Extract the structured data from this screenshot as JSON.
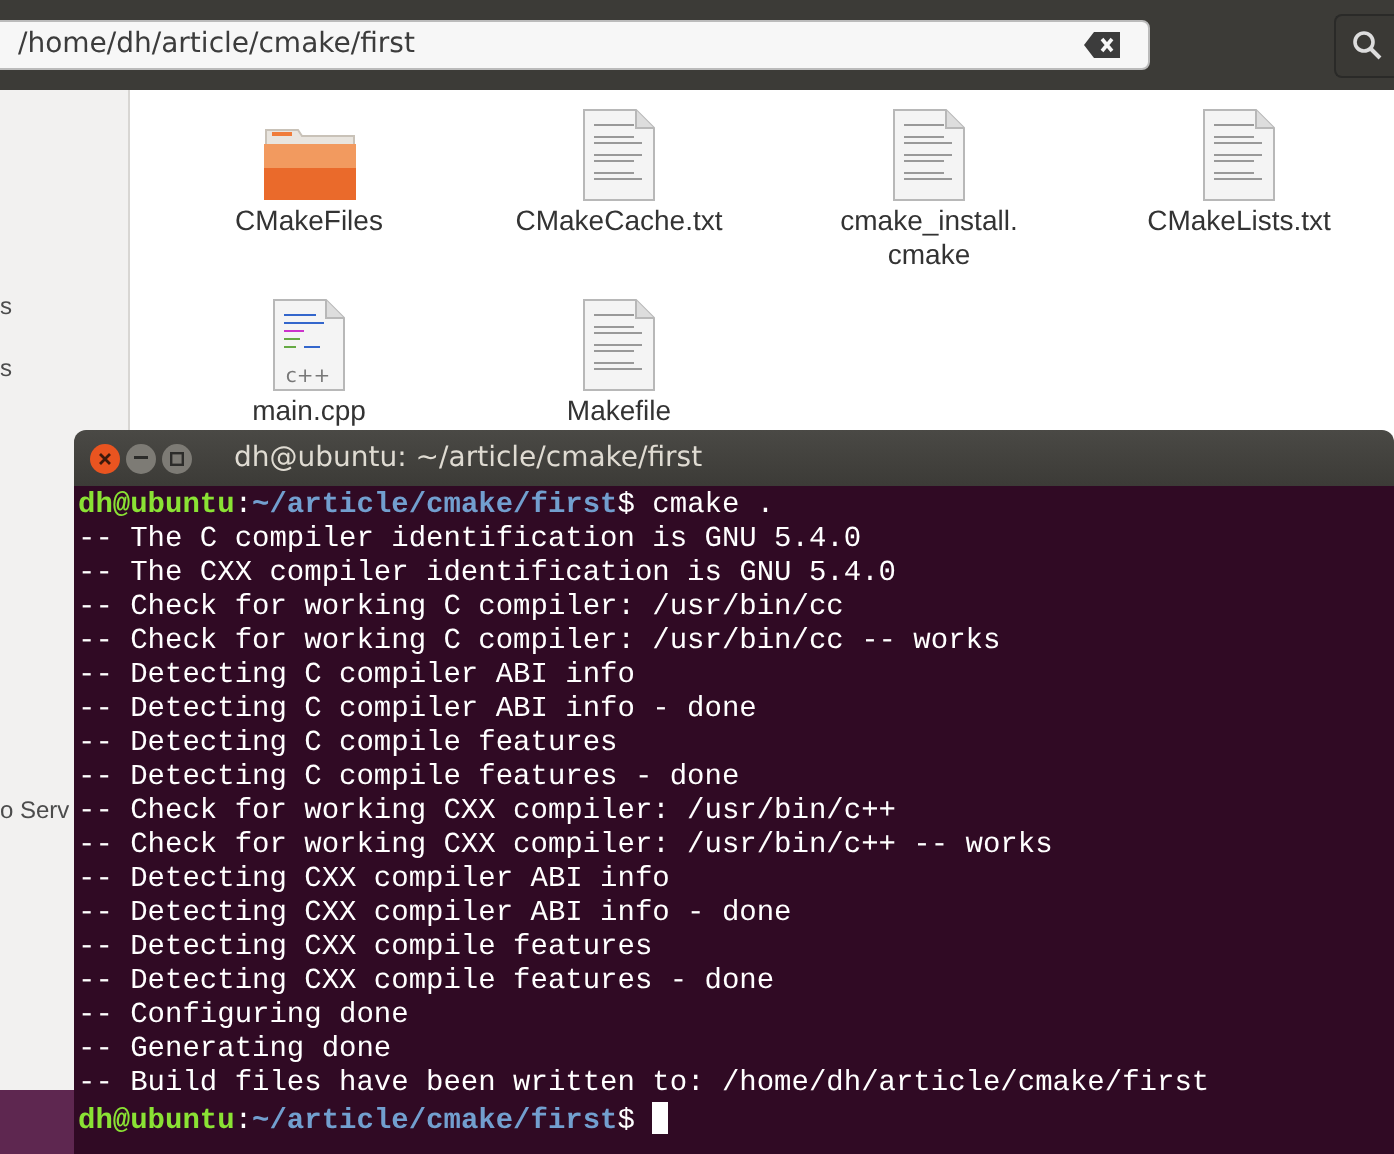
{
  "file_manager": {
    "path": "/home/dh/article/cmake/first",
    "sidebar_items": [
      {
        "label": "s"
      },
      {
        "label": "s"
      },
      {
        "label": "o Serv"
      }
    ],
    "files": [
      {
        "name": "CMakeFiles",
        "kind": "folder"
      },
      {
        "name": "CMakeCache.txt",
        "kind": "text"
      },
      {
        "name": "cmake_install.\ncmake",
        "kind": "text"
      },
      {
        "name": "CMakeLists.txt",
        "kind": "text"
      },
      {
        "name": "main.cpp",
        "kind": "source",
        "icon_label": "c++"
      },
      {
        "name": "Makefile",
        "kind": "text"
      }
    ]
  },
  "terminal": {
    "title": "dh@ubuntu: ~/article/cmake/first",
    "lines": [
      {
        "segments": [
          {
            "kind": "user",
            "text": "dh@ubuntu"
          },
          {
            "kind": "plain",
            "text": ":"
          },
          {
            "kind": "path",
            "text": "~/article/cmake/first"
          },
          {
            "kind": "plain",
            "text": "$ cmake ."
          }
        ]
      },
      {
        "segments": [
          {
            "kind": "plain",
            "text": "-- The C compiler identification is GNU 5.4.0"
          }
        ]
      },
      {
        "segments": [
          {
            "kind": "plain",
            "text": "-- The CXX compiler identification is GNU 5.4.0"
          }
        ]
      },
      {
        "segments": [
          {
            "kind": "plain",
            "text": "-- Check for working C compiler: /usr/bin/cc"
          }
        ]
      },
      {
        "segments": [
          {
            "kind": "plain",
            "text": "-- Check for working C compiler: /usr/bin/cc -- works"
          }
        ]
      },
      {
        "segments": [
          {
            "kind": "plain",
            "text": "-- Detecting C compiler ABI info"
          }
        ]
      },
      {
        "segments": [
          {
            "kind": "plain",
            "text": "-- Detecting C compiler ABI info - done"
          }
        ]
      },
      {
        "segments": [
          {
            "kind": "plain",
            "text": "-- Detecting C compile features"
          }
        ]
      },
      {
        "segments": [
          {
            "kind": "plain",
            "text": "-- Detecting C compile features - done"
          }
        ]
      },
      {
        "segments": [
          {
            "kind": "plain",
            "text": "-- Check for working CXX compiler: /usr/bin/c++"
          }
        ]
      },
      {
        "segments": [
          {
            "kind": "plain",
            "text": "-- Check for working CXX compiler: /usr/bin/c++ -- works"
          }
        ]
      },
      {
        "segments": [
          {
            "kind": "plain",
            "text": "-- Detecting CXX compiler ABI info"
          }
        ]
      },
      {
        "segments": [
          {
            "kind": "plain",
            "text": "-- Detecting CXX compiler ABI info - done"
          }
        ]
      },
      {
        "segments": [
          {
            "kind": "plain",
            "text": "-- Detecting CXX compile features"
          }
        ]
      },
      {
        "segments": [
          {
            "kind": "plain",
            "text": "-- Detecting CXX compile features - done"
          }
        ]
      },
      {
        "segments": [
          {
            "kind": "plain",
            "text": "-- Configuring done"
          }
        ]
      },
      {
        "segments": [
          {
            "kind": "plain",
            "text": "-- Generating done"
          }
        ]
      },
      {
        "segments": [
          {
            "kind": "plain",
            "text": "-- Build files have been written to: /home/dh/article/cmake/first"
          }
        ]
      },
      {
        "segments": [
          {
            "kind": "user",
            "text": "dh@ubuntu"
          },
          {
            "kind": "plain",
            "text": ":"
          },
          {
            "kind": "path",
            "text": "~/article/cmake/first"
          },
          {
            "kind": "plain",
            "text": "$ "
          }
        ],
        "cursor": true
      }
    ]
  }
}
